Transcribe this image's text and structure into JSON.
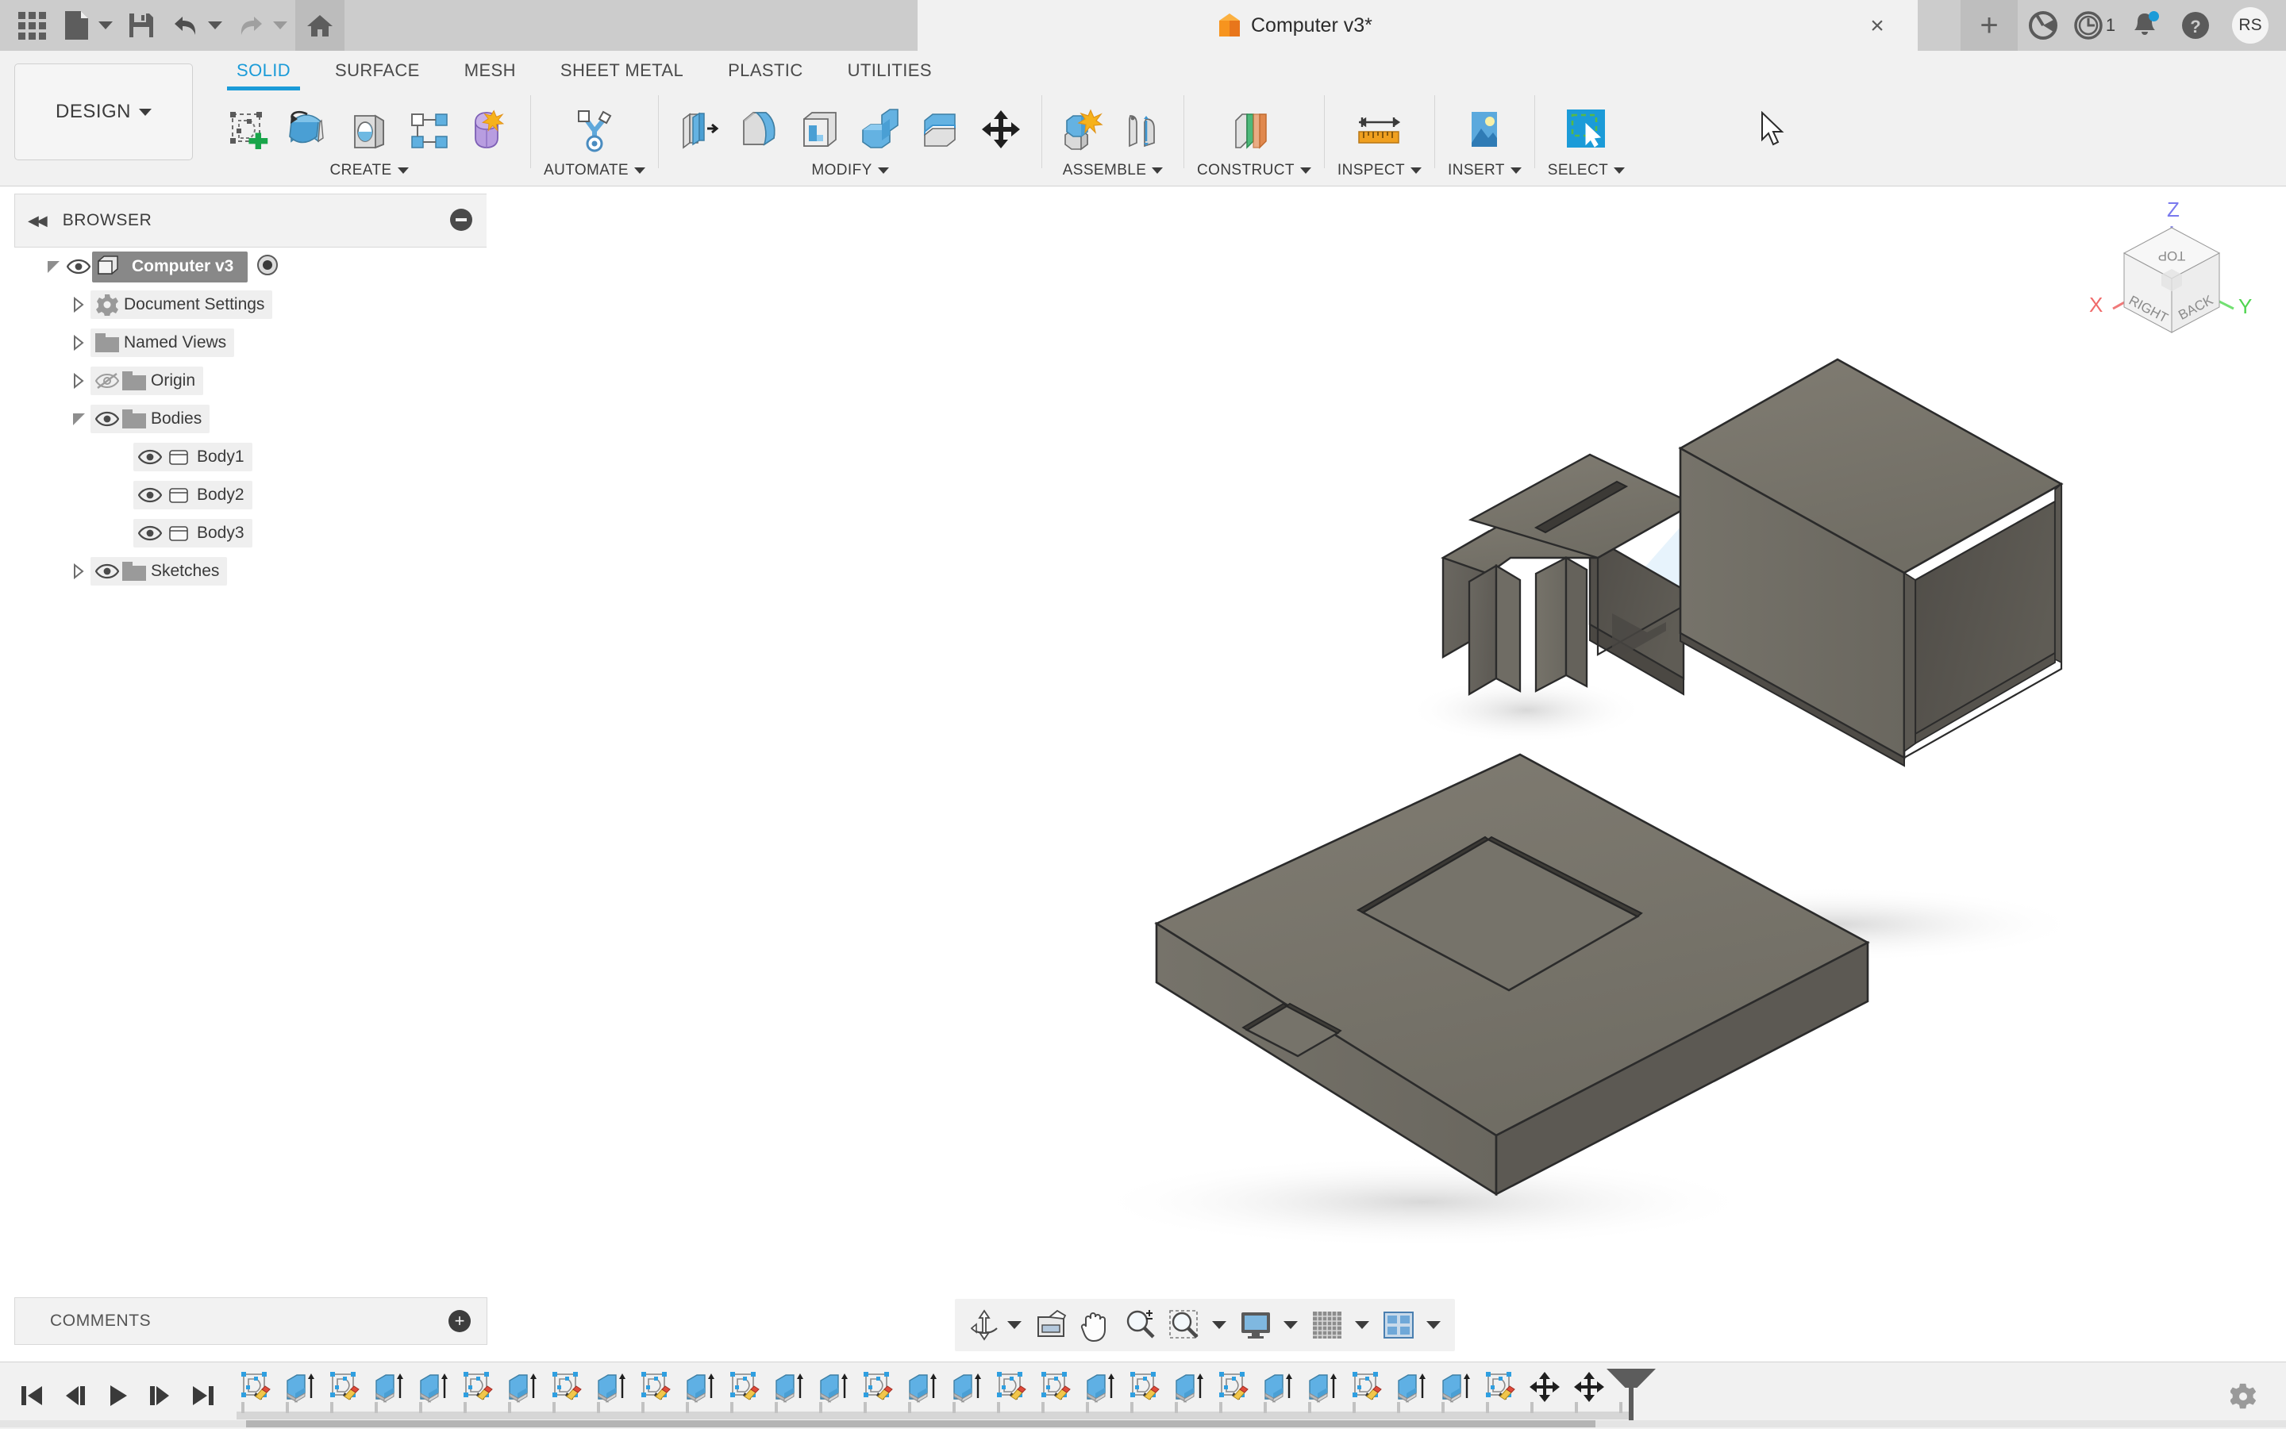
{
  "titlebar": {
    "app_title": "Computer v3*",
    "close_label": "×",
    "new_tab_label": "+",
    "job_count": "1",
    "avatar_initials": "RS",
    "icons": [
      "app-grid-icon",
      "new-document-icon",
      "save-icon",
      "undo-icon",
      "redo-icon",
      "home-icon",
      "extension-icon",
      "job-status-icon",
      "notifications-icon",
      "help-icon"
    ]
  },
  "ribbon": {
    "design_label": "DESIGN",
    "tabs": [
      {
        "label": "SOLID",
        "active": true
      },
      {
        "label": "SURFACE",
        "active": false
      },
      {
        "label": "MESH",
        "active": false
      },
      {
        "label": "SHEET METAL",
        "active": false
      },
      {
        "label": "PLASTIC",
        "active": false
      },
      {
        "label": "UTILITIES",
        "active": false
      }
    ],
    "groups": [
      {
        "label": "CREATE",
        "tools": [
          "new-sketch-icon",
          "extrude-icon",
          "revolve-icon",
          "pattern-icon",
          "create-form-icon"
        ]
      },
      {
        "label": "AUTOMATE",
        "tools": [
          "automate-icon"
        ]
      },
      {
        "label": "MODIFY",
        "tools": [
          "press-pull-icon",
          "fillet-icon",
          "shell-icon",
          "combine-icon",
          "split-face-icon",
          "move-copy-icon"
        ]
      },
      {
        "label": "ASSEMBLE",
        "tools": [
          "new-component-icon",
          "joint-icon"
        ]
      },
      {
        "label": "CONSTRUCT",
        "tools": [
          "offset-plane-icon"
        ]
      },
      {
        "label": "INSPECT",
        "tools": [
          "measure-icon"
        ]
      },
      {
        "label": "INSERT",
        "tools": [
          "insert-image-icon"
        ]
      },
      {
        "label": "SELECT",
        "tools": [
          "select-window-icon"
        ]
      }
    ]
  },
  "browser": {
    "title": "BROWSER",
    "collapse_label": "◀◀",
    "tree": [
      {
        "label": "Computer v3",
        "indent": 0,
        "twisty": "open",
        "eye": "visible",
        "icon": "component-icon",
        "selected": true,
        "radio": true
      },
      {
        "label": "Document Settings",
        "indent": 1,
        "twisty": "closed",
        "eye": "none",
        "icon": "gear-icon",
        "selected": false
      },
      {
        "label": "Named Views",
        "indent": 1,
        "twisty": "closed",
        "eye": "none",
        "icon": "folder-icon",
        "selected": false
      },
      {
        "label": "Origin",
        "indent": 1,
        "twisty": "closed",
        "eye": "hidden",
        "icon": "folder-icon",
        "selected": false
      },
      {
        "label": "Bodies",
        "indent": 1,
        "twisty": "open",
        "eye": "visible",
        "icon": "folder-icon",
        "selected": false
      },
      {
        "label": "Body1",
        "indent": 2,
        "twisty": "none",
        "eye": "visible",
        "icon": "body-icon",
        "selected": false
      },
      {
        "label": "Body2",
        "indent": 2,
        "twisty": "none",
        "eye": "visible",
        "icon": "body-icon",
        "selected": false
      },
      {
        "label": "Body3",
        "indent": 2,
        "twisty": "none",
        "eye": "visible",
        "icon": "body-icon",
        "selected": false
      },
      {
        "label": "Sketches",
        "indent": 1,
        "twisty": "closed",
        "eye": "visible",
        "icon": "folder-icon",
        "selected": false
      }
    ]
  },
  "comments": {
    "title": "COMMENTS",
    "add_label": "+"
  },
  "viewcube": {
    "faces": {
      "top": "TOP",
      "left": "RIGHT",
      "right": "BACK"
    },
    "axes": {
      "x": "X",
      "y": "Y",
      "z": "Z"
    },
    "axis_colors": {
      "x": "#f06a6a",
      "y": "#4fd44f",
      "z": "#7a7aee"
    }
  },
  "navbar": {
    "items": [
      "orbit-icon",
      "look-at-icon",
      "pan-icon",
      "zoom-icon",
      "zoom-window-icon",
      "display-settings-icon",
      "grid-snap-icon",
      "viewports-icon"
    ]
  },
  "timeline": {
    "playback": [
      "skip-to-start-icon",
      "step-back-icon",
      "play-icon",
      "step-forward-icon",
      "skip-to-end-icon"
    ],
    "features": [
      "sketch",
      "extrude",
      "sketch",
      "extrude",
      "extrude",
      "sketch",
      "extrude",
      "sketch",
      "extrude",
      "sketch",
      "extrude",
      "sketch",
      "extrude",
      "extrude",
      "sketch",
      "extrude",
      "extrude",
      "sketch",
      "sketch",
      "extrude",
      "sketch",
      "extrude",
      "sketch",
      "extrude",
      "extrude",
      "sketch",
      "extrude",
      "extrude",
      "sketch",
      "move",
      "move"
    ],
    "settings_label": "settings-gear-icon"
  },
  "canvas": {
    "background": "#ffffff",
    "body_color": "#76736a",
    "bodies": [
      {
        "name": "Body1",
        "desc": "bracket with slot and fins"
      },
      {
        "name": "Body2",
        "desc": "hollow rectangular enclosure"
      },
      {
        "name": "Body3",
        "desc": "flat plate with two recessed pockets"
      }
    ],
    "cursor": "arrow-cursor"
  },
  "colors": {
    "accent": "#1b9bd8",
    "titlebar_bg": "#cccccc",
    "ribbon_bg": "#f1f1f1",
    "panel_bg": "#f2f2f2",
    "body_fill": "#76736a"
  }
}
